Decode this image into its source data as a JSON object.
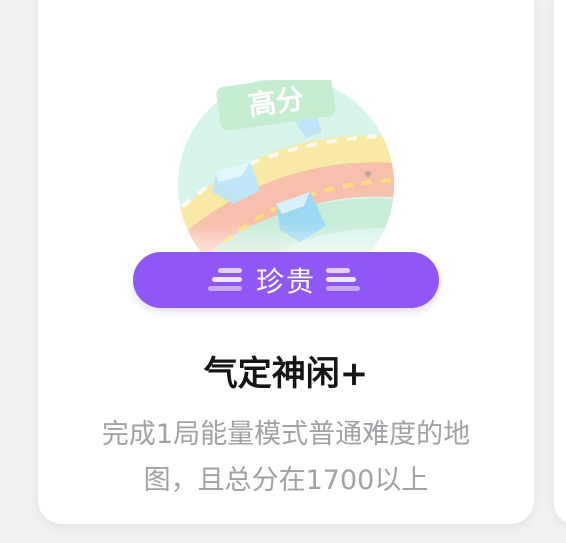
{
  "achievement": {
    "badge_text": "高分",
    "rarity": "珍贵",
    "title": "气定神闲+",
    "description": "完成1局能量模式普通难度的地图，且总分在1700以上"
  },
  "colors": {
    "pill": "#8f57f5",
    "title": "#151515",
    "description": "#a2a2a6",
    "card": "#ffffff",
    "background": "#f1f1f3"
  },
  "icons": {
    "badge": "map-badge-icon",
    "decor": "stripe-decoration-icon"
  }
}
